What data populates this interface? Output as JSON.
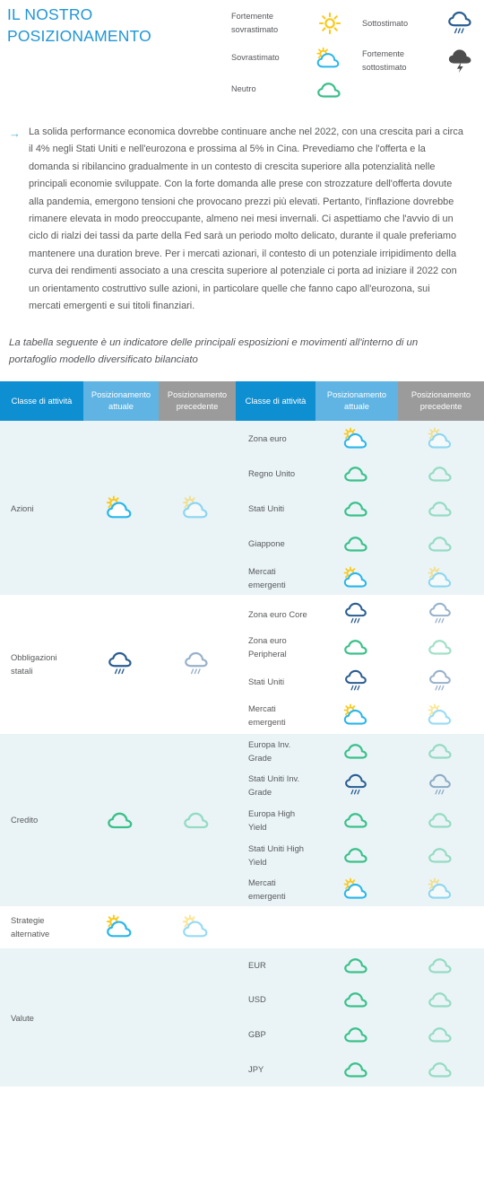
{
  "header": {
    "title": "IL NOSTRO POSIZIONAMENTO",
    "legend": {
      "left_column": [
        {
          "label": "Fortemente sovrastimato",
          "icon": "sun-icon"
        },
        {
          "label": "Sovrastimato",
          "icon": "sun-cloud-icon"
        },
        {
          "label": "Neutro",
          "icon": "cloud-icon"
        }
      ],
      "right_column": [
        {
          "label": "Sottostimato",
          "icon": "rain-cloud-icon"
        },
        {
          "label": "Fortemente sottostimato",
          "icon": "storm-cloud-icon"
        }
      ]
    }
  },
  "bullet": {
    "arrow": "→",
    "text": "La solida performance economica dovrebbe continuare anche nel 2022, con una crescita pari a circa il 4% negli Stati Uniti e nell'eurozona e prossima al 5% in Cina. Prevediamo che l'offerta e la domanda si ribilancino gradualmente in un contesto di crescita superiore alla potenzialità nelle principali economie sviluppate. Con la forte domanda alle prese con strozzature dell'offerta dovute alla pandemia, emergono tensioni che provocano prezzi più elevati. Pertanto, l'inflazione dovrebbe rimanere elevata in modo preoccupante, almeno nei mesi invernali. Ci aspettiamo che l'avvio di un ciclo di rialzi dei tassi da parte della Fed sarà un periodo molto delicato, durante il quale preferiamo mantenere una duration breve. Per i mercati azionari, il contesto di un potenziale irripidimento della curva dei rendimenti associato a una crescita superiore al potenziale ci porta ad iniziare il 2022 con un orientamento costruttivo sulle azioni, in particolare quelle che fanno capo all'eurozona, sui mercati emergenti e sui titoli finanziari."
  },
  "subtitle": "La tabella seguente è un indicatore delle principali esposizioni e movimenti all'interno di un portafoglio modello diversificato bilanciato",
  "table": {
    "headers": [
      "Classe di attività",
      "Posizionamento attuale",
      "Posizionamento precedente",
      "Classe di attività",
      "Posizionamento attuale",
      "Posizionamento precedente"
    ],
    "groups": [
      {
        "name": "Azioni",
        "current": "sun-cloud-icon",
        "previous": "sun-cloud-icon",
        "tint": true,
        "rows": [
          {
            "label": "Zona euro",
            "current": "sun-cloud-icon",
            "previous": "sun-cloud-icon"
          },
          {
            "label": "Regno Unito",
            "current": "cloud-icon",
            "previous": "cloud-icon"
          },
          {
            "label": "Stati Uniti",
            "current": "cloud-icon",
            "previous": "cloud-icon"
          },
          {
            "label": "Giappone",
            "current": "cloud-icon",
            "previous": "cloud-icon"
          },
          {
            "label": "Mercati emergenti",
            "current": "sun-cloud-icon",
            "previous": "sun-cloud-icon"
          }
        ]
      },
      {
        "name": "Obbligazioni statali",
        "current": "rain-cloud-icon",
        "previous": "rain-cloud-icon",
        "tint": false,
        "rows": [
          {
            "label": "Zona euro Core",
            "current": "rain-cloud-icon",
            "previous": "rain-cloud-icon"
          },
          {
            "label": "Zona euro Peripheral",
            "current": "cloud-icon",
            "previous": "cloud-icon"
          },
          {
            "label": "Stati Uniti",
            "current": "rain-cloud-icon",
            "previous": "rain-cloud-icon"
          },
          {
            "label": "Mercati emergenti",
            "current": "sun-cloud-icon",
            "previous": "sun-cloud-icon"
          }
        ]
      },
      {
        "name": "Credito",
        "current": "cloud-icon",
        "previous": "cloud-icon",
        "tint": true,
        "rows": [
          {
            "label": "Europa Inv. Grade",
            "current": "cloud-icon",
            "previous": "cloud-icon"
          },
          {
            "label": "Stati Uniti Inv. Grade",
            "current": "rain-cloud-icon",
            "previous": "rain-cloud-icon"
          },
          {
            "label": "Europa High Yield",
            "current": "cloud-icon",
            "previous": "cloud-icon"
          },
          {
            "label": "Stati Uniti High Yield",
            "current": "cloud-icon",
            "previous": "cloud-icon"
          },
          {
            "label": "Mercati emergenti",
            "current": "sun-cloud-icon",
            "previous": "sun-cloud-icon"
          }
        ]
      },
      {
        "name": "Strategie alternative",
        "current": "sun-cloud-icon",
        "previous": "sun-cloud-icon",
        "tint": false,
        "rows": []
      },
      {
        "name": "Valute",
        "current": "",
        "previous": "",
        "tint": true,
        "rows": [
          {
            "label": "EUR",
            "current": "cloud-icon",
            "previous": "cloud-icon"
          },
          {
            "label": "USD",
            "current": "cloud-icon",
            "previous": "cloud-icon"
          },
          {
            "label": "GBP",
            "current": "cloud-icon",
            "previous": "cloud-icon"
          },
          {
            "label": "JPY",
            "current": "cloud-icon",
            "previous": "cloud-icon"
          }
        ]
      }
    ]
  },
  "colors": {
    "title_blue": "#2196d6",
    "header_dark_blue": "#0e8fd2",
    "header_light_blue": "#5fb4e3",
    "header_gray": "#9b9b9b",
    "row_tint": "#eaf4f7",
    "text_gray": "#58595b",
    "sun_yellow": "#fbc91b",
    "cloud_blue": "#29b6ea",
    "cloud_green": "#3bc08a",
    "rain_navy": "#2a5d91",
    "storm_gray": "#4d4d4d"
  }
}
